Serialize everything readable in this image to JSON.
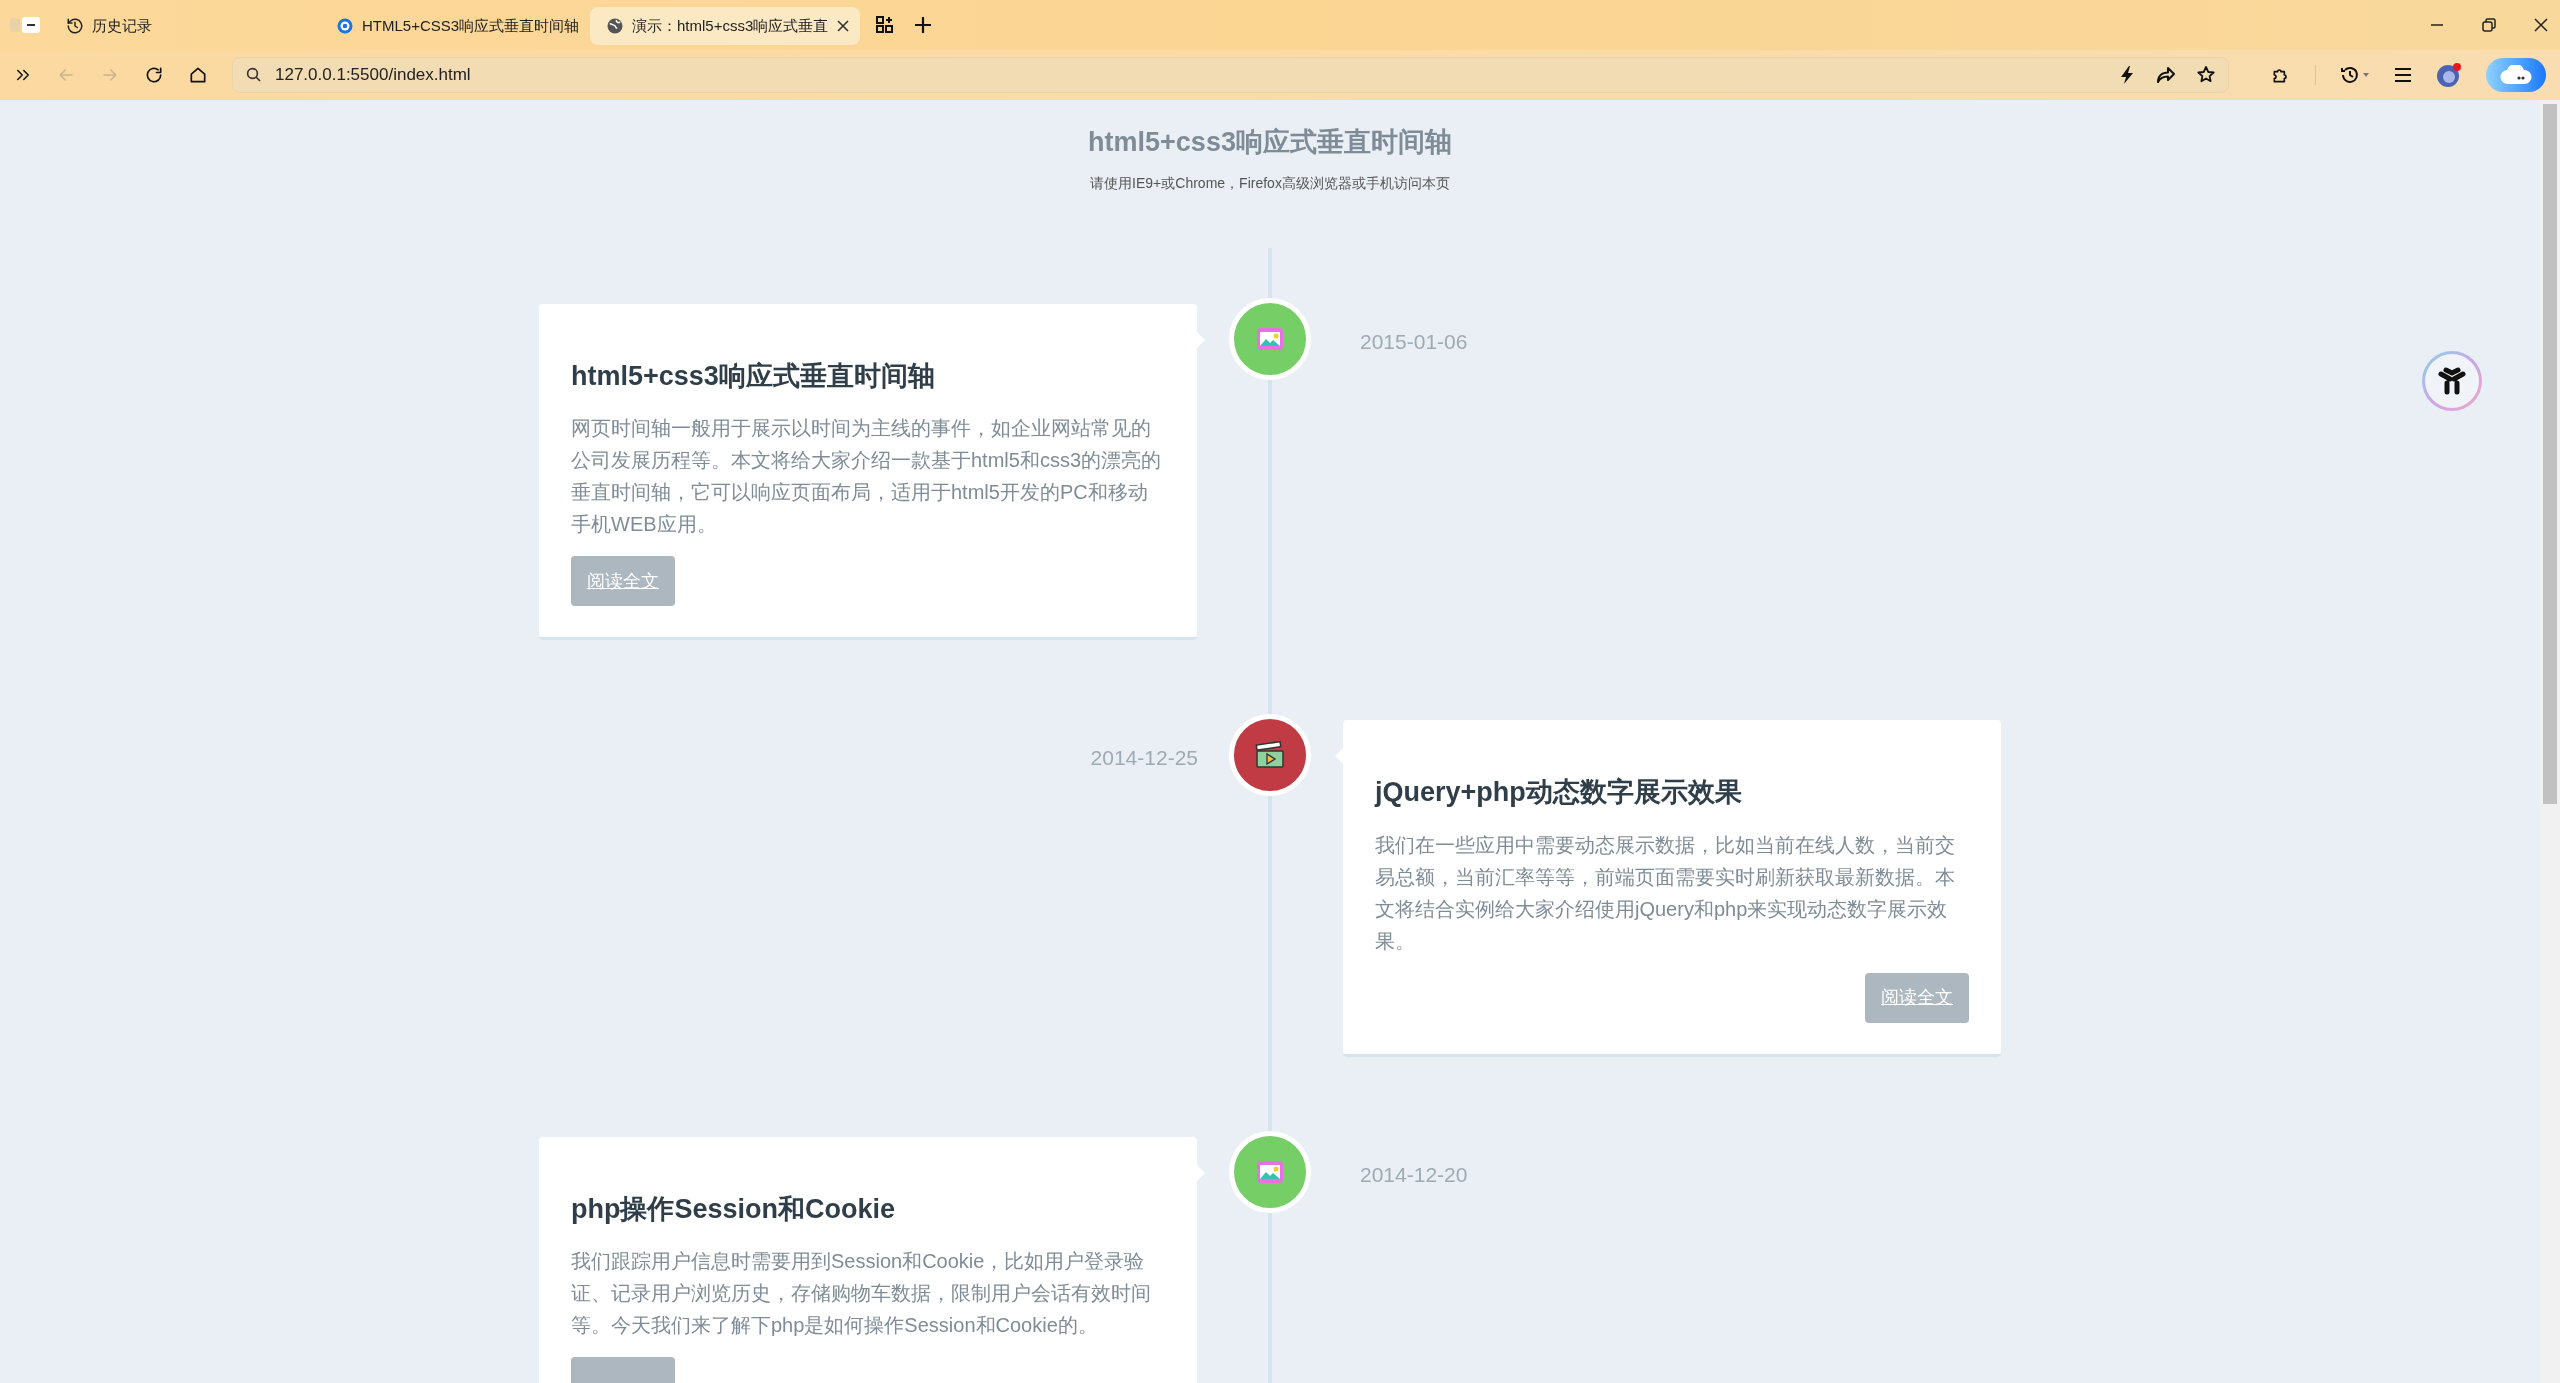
{
  "browser": {
    "tabs": [
      {
        "title": "历史记录",
        "kind": "history",
        "selected": false
      },
      {
        "title": "HTML5+CSS3响应式垂直时间轴",
        "kind": "site",
        "selected": false
      },
      {
        "title": "演示：html5+css3响应式垂直",
        "kind": "globe",
        "selected": true
      }
    ],
    "nav": [
      {
        "kind": "back",
        "disabled": true
      },
      {
        "kind": "forward",
        "disabled": true
      },
      {
        "kind": "reload",
        "disabled": false
      },
      {
        "kind": "home",
        "disabled": false
      }
    ],
    "address": "127.0.0.1:5500/index.html"
  },
  "page": {
    "title": "html5+css3响应式垂直时间轴",
    "subtitle": "请使用IE9+或Chrome，Firefox高级浏览器或手机访问本页",
    "entries": [
      {
        "kind": "picture",
        "color": "#75ce66",
        "date": "2015-01-06",
        "title": "html5+css3响应式垂直时间轴",
        "body": "网页时间轴一般用于展示以时间为主线的事件，如企业网站常见的公司发展历程等。本文将给大家介绍一款基于html5和css3的漂亮的垂直时间轴，它可以响应页面布局，适用于html5开发的PC和移动手机WEB应用。",
        "button": "阅读全文"
      },
      {
        "kind": "movie",
        "color": "#c03b44",
        "date": "2014-12-25",
        "title": "jQuery+php动态数字展示效果",
        "body": "我们在一些应用中需要动态展示数据，比如当前在线人数，当前交易总额，当前汇率等等，前端页面需要实时刷新获取最新数据。本文将结合实例给大家介绍使用jQuery和php来实现动态数字展示效果。",
        "button": "阅读全文"
      },
      {
        "kind": "picture",
        "color": "#75ce66",
        "date": "2014-12-20",
        "title": "php操作Session和Cookie",
        "body": "我们跟踪用户信息时需要用到Session和Cookie，比如用户登录验证、记录用户浏览历史，存储购物车数据，限制用户会话有效时间等。今天我们来了解下php是如何操作Session和Cookie的。"
      }
    ]
  }
}
